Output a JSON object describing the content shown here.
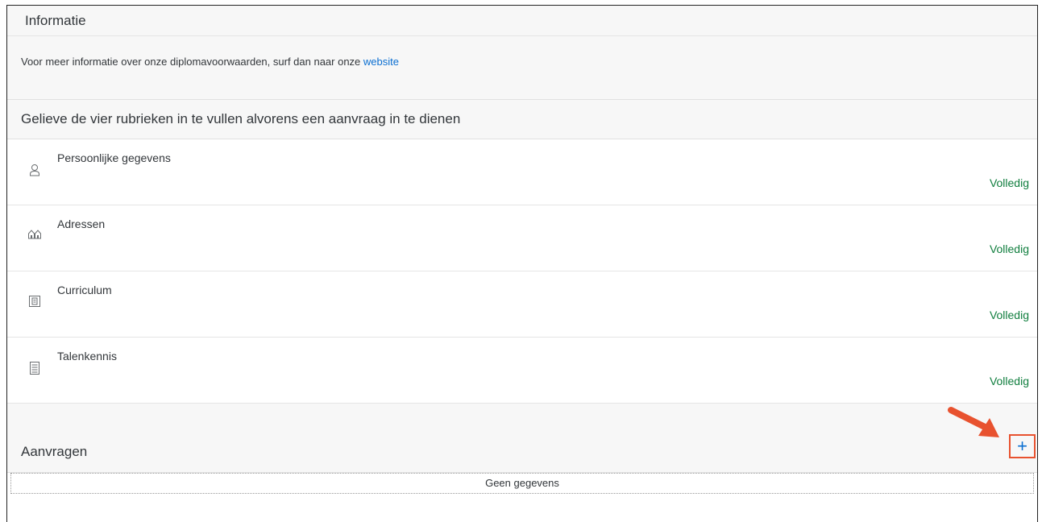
{
  "info": {
    "title": "Informatie",
    "text": "Voor meer informatie over onze diplomavoorwaarden, surf dan naar onze ",
    "link": "website"
  },
  "rubrieken": {
    "title": "Gelieve de vier rubrieken in te vullen alvorens een aanvraag in te dienen",
    "items": [
      {
        "label": "Persoonlijke gegevens",
        "status": "Volledig",
        "icon": "person-icon"
      },
      {
        "label": "Adressen",
        "status": "Volledig",
        "icon": "houses-icon"
      },
      {
        "label": "Curriculum",
        "status": "Volledig",
        "icon": "curriculum-icon"
      },
      {
        "label": "Talenkennis",
        "status": "Volledig",
        "icon": "document-icon"
      }
    ]
  },
  "aanvragen": {
    "title": "Aanvragen",
    "add_label": "+",
    "empty_text": "Geen gegevens"
  },
  "colors": {
    "status_green": "#107e3e",
    "link_blue": "#0a6ed1",
    "highlight_orange": "#e8522f"
  }
}
